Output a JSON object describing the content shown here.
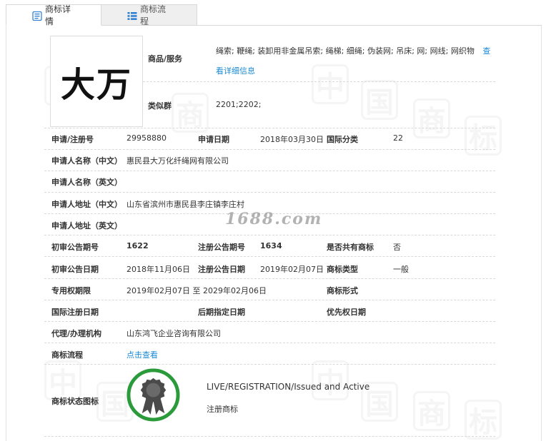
{
  "tabs": [
    {
      "label": "商标详情",
      "icon": "document-icon",
      "active": true
    },
    {
      "label": "商标流程",
      "icon": "list-icon",
      "active": false
    }
  ],
  "logo_text": "大万",
  "goods": {
    "label": "商品/服务",
    "value": "绳索; 鞭绳; 装卸用非金属吊索; 绳梯; 细绳; 伪装网; 吊床; 网; 网线; 网织物",
    "more_link": "查看详细信息"
  },
  "similar_groups": {
    "label": "类似群",
    "value": "2201;2202;"
  },
  "rows": {
    "reg_no_label": "申请/注册号",
    "reg_no": "29958880",
    "apply_date_label": "申请日期",
    "apply_date": "2018年03月30日",
    "intl_class_label": "国际分类",
    "intl_class": "22",
    "applicant_cn_label": "申请人名称（中文）",
    "applicant_cn": "惠民县大万化纤绳网有限公司",
    "applicant_en_label": "申请人名称（英文）",
    "applicant_en": "",
    "address_cn_label": "申请人地址（中文）",
    "address_cn": "山东省滨州市惠民县李庄镇李庄村",
    "address_en_label": "申请人地址（英文）",
    "address_en": "",
    "prelim_no_label": "初审公告期号",
    "prelim_no": "1622",
    "reg_notice_no_label": "注册公告期号",
    "reg_notice_no": "1634",
    "shared_label": "是否共有商标",
    "shared": "否",
    "prelim_date_label": "初审公告日期",
    "prelim_date": "2018年11月06日",
    "reg_notice_date_label": "注册公告日期",
    "reg_notice_date": "2019年02月07日",
    "tm_type_label": "商标类型",
    "tm_type": "一般",
    "exclusive_label": "专用权期限",
    "exclusive": "2019年02月07日 至 2029年02月06日",
    "tm_form_label": "商标形式",
    "tm_form": "",
    "intl_reg_date_label": "国际注册日期",
    "intl_reg_date": "",
    "later_date_label": "后期指定日期",
    "later_date": "",
    "priority_date_label": "优先权日期",
    "priority_date": "",
    "agent_label": "代理/办理机构",
    "agent": "山东鸿飞企业咨询有限公司",
    "process_label": "商标流程",
    "process_link": "点击查看",
    "status_icon_label": "商标状态图标",
    "status_en": "LIVE/REGISTRATION/Issued and Active",
    "status_cn": "注册商标"
  },
  "watermark": "1688.com",
  "watermark_chars": [
    "中",
    "国",
    "商",
    "标"
  ],
  "colors": {
    "link": "#1a8ad4",
    "badge_ring": "#2a9a3a",
    "badge_dark": "#4a4a4a"
  }
}
